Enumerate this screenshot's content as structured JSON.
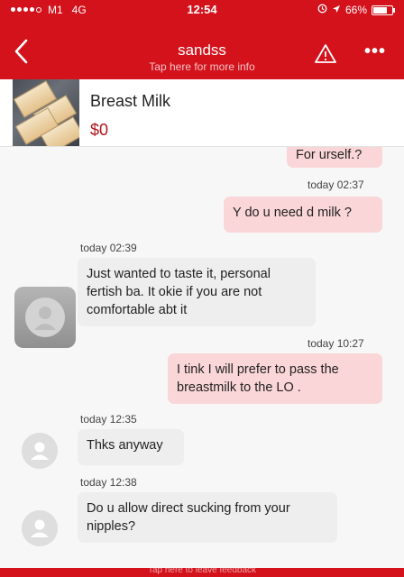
{
  "status_bar": {
    "carrier": "M1",
    "network": "4G",
    "time": "12:54",
    "battery": "66%"
  },
  "nav": {
    "back_icon": "chevron-left-icon",
    "title": "sandss",
    "subtitle": "Tap here for more info",
    "warning_icon": "warning-icon",
    "more_label": "•••"
  },
  "product": {
    "name": "Breast Milk",
    "price": "$0"
  },
  "messages": [
    {
      "side": "out",
      "text": "For urself.?"
    },
    {
      "timestamp": "today 02:37",
      "side": "out",
      "text": "Y do u need d milk ?"
    },
    {
      "timestamp": "today 02:39",
      "side": "in",
      "text": "Just wanted to taste it, personal fertish ba. It okie if you are not comfortable abt it"
    },
    {
      "timestamp": "today 10:27",
      "side": "out",
      "text": "I tink I will prefer to pass the breastmilk to the LO ."
    },
    {
      "timestamp": "today 12:35",
      "side": "in",
      "text": "Thks anyway"
    },
    {
      "timestamp": "today 12:38",
      "side": "in",
      "text": "Do u allow direct sucking from your nipples?"
    }
  ],
  "footer": {
    "label": "Tap here to leave feedback"
  },
  "colors": {
    "brand_red": "#d3121c",
    "outgoing_bubble": "#fbd6d8",
    "incoming_bubble": "#eeeeee",
    "price_red": "#b0141c"
  }
}
